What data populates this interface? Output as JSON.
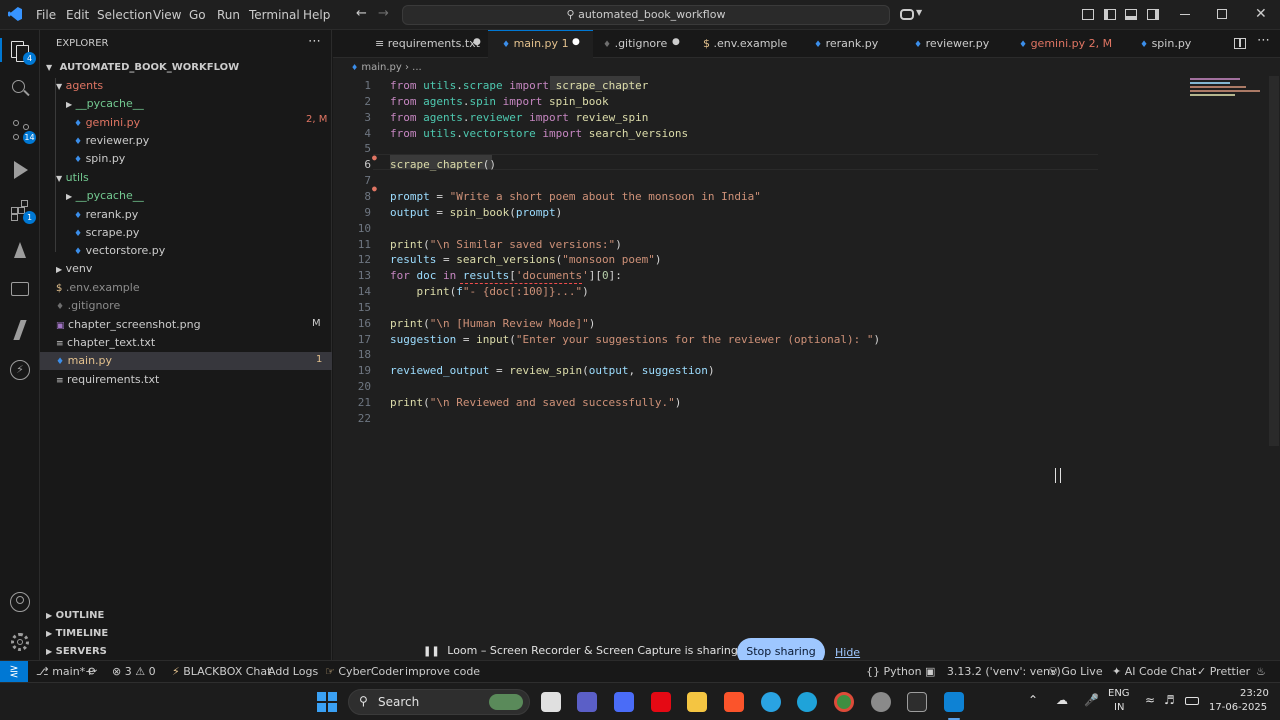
{
  "titlebar": {
    "menu": [
      "File",
      "Edit",
      "Selection",
      "View",
      "Go",
      "Run",
      "Terminal",
      "Help"
    ],
    "search_text": "automated_book_workflow"
  },
  "activity": {
    "scm_badge": "14",
    "ext_badge": "1"
  },
  "explorer": {
    "title": "EXPLORER",
    "root": "AUTOMATED_BOOK_WORKFLOW",
    "items": [
      {
        "label": "agents",
        "color": "#e07563"
      },
      {
        "label": "__pycache__",
        "color": "#73c991"
      },
      {
        "label": "gemini.py",
        "color": "#e07563",
        "status": "2, M"
      },
      {
        "label": "reviewer.py",
        "color": "#cccccc"
      },
      {
        "label": "spin.py",
        "color": "#cccccc"
      },
      {
        "label": "utils",
        "color": "#73c991"
      },
      {
        "label": "__pycache__",
        "color": "#73c991"
      },
      {
        "label": "rerank.py",
        "color": "#cccccc"
      },
      {
        "label": "scrape.py",
        "color": "#cccccc"
      },
      {
        "label": "vectorstore.py",
        "color": "#cccccc"
      },
      {
        "label": "venv",
        "color": "#cccccc"
      },
      {
        "label": ".env.example",
        "color": "#8c8c8c"
      },
      {
        "label": ".gitignore",
        "color": "#8c8c8c"
      },
      {
        "label": "chapter_screenshot.png",
        "color": "#cccccc",
        "status": "M"
      },
      {
        "label": "chapter_text.txt",
        "color": "#cccccc"
      },
      {
        "label": "main.py",
        "color": "#e2c08d",
        "status": "1"
      },
      {
        "label": "requirements.txt",
        "color": "#cccccc"
      }
    ],
    "outline": "OUTLINE",
    "timeline": "TIMELINE",
    "servers": "SERVERS"
  },
  "tabs": [
    {
      "label": "requirements.txt",
      "color": "#cccccc"
    },
    {
      "label": "main.py",
      "color": "#e2c08d",
      "status": "1"
    },
    {
      "label": ".gitignore",
      "color": "#cccccc"
    },
    {
      "label": ".env.example",
      "color": "#cccccc"
    },
    {
      "label": "rerank.py",
      "color": "#cccccc"
    },
    {
      "label": "reviewer.py",
      "color": "#cccccc"
    },
    {
      "label": "gemini.py",
      "color": "#e07563",
      "status": "2, M"
    },
    {
      "label": "spin.py",
      "color": "#cccccc"
    }
  ],
  "breadcrumb": {
    "file": "main.py",
    "rest": "..."
  },
  "code_lines": [
    {
      "n": "1",
      "t": "from utils.scrape import scrape_chapter"
    },
    {
      "n": "2",
      "t": "from agents.spin import spin_book"
    },
    {
      "n": "3",
      "t": "from agents.reviewer import review_spin"
    },
    {
      "n": "4",
      "t": "from utils.vectorstore import search_versions"
    },
    {
      "n": "5",
      "t": ""
    },
    {
      "n": "6",
      "t": "scrape_chapter()"
    },
    {
      "n": "7",
      "t": ""
    },
    {
      "n": "8",
      "t": "prompt = \"Write a short poem about the monsoon in India\""
    },
    {
      "n": "9",
      "t": "output = spin_book(prompt)"
    },
    {
      "n": "10",
      "t": ""
    },
    {
      "n": "11",
      "t": "print(\"\\n Similar saved versions:\")"
    },
    {
      "n": "12",
      "t": "results = search_versions(\"monsoon poem\")"
    },
    {
      "n": "13",
      "t": "for doc in results['documents'][0]:"
    },
    {
      "n": "14",
      "t": "    print(f\"- {doc[:100]}...\")"
    },
    {
      "n": "15",
      "t": ""
    },
    {
      "n": "16",
      "t": "print(\"\\n [Human Review Mode]\")"
    },
    {
      "n": "17",
      "t": "suggestion = input(\"Enter your suggestions for the reviewer (optional): \")"
    },
    {
      "n": "18",
      "t": ""
    },
    {
      "n": "19",
      "t": "reviewed_output = review_spin(output, suggestion)"
    },
    {
      "n": "20",
      "t": ""
    },
    {
      "n": "21",
      "t": "print(\"\\n Reviewed and saved successfully.\")"
    },
    {
      "n": "22",
      "t": ""
    }
  ],
  "loom": {
    "message": "Loom – Screen Recorder & Screen Capture is sharing your screen.",
    "stop": "Stop sharing",
    "hide": "Hide"
  },
  "statusbar": {
    "branch": "main*+",
    "errors": "3",
    "warnings": "0",
    "blackbox": "BLACKBOX Chat",
    "addlogs": "Add Logs",
    "cyber": "CyberCoder",
    "imp": "improve code",
    "lang": "Python",
    "interp": "3.13.2 ('venv': venv)",
    "golive": "Go Live",
    "aichat": "AI Code Chat",
    "prettier": "Prettier"
  },
  "taskbar": {
    "search": "Search",
    "lang_top": "ENG",
    "lang_bottom": "IN",
    "time": "23:20",
    "date": "17-06-2025"
  }
}
